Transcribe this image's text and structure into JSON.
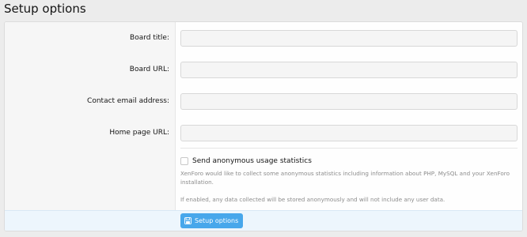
{
  "page": {
    "title": "Setup options"
  },
  "form": {
    "fields": [
      {
        "label": "Board title:",
        "value": "",
        "placeholder": ""
      },
      {
        "label": "Board URL:",
        "value": "",
        "placeholder": ""
      },
      {
        "label": "Contact email address:",
        "value": "",
        "placeholder": ""
      },
      {
        "label": "Home page URL:",
        "value": "",
        "placeholder": ""
      }
    ],
    "stats": {
      "label": "Send anonymous usage statistics",
      "checked": false,
      "hint_1": "XenForo would like to collect some anonymous statistics including information about PHP, MySQL and your XenForo installation.",
      "hint_2": "If enabled, any data collected will be stored anonymously and will not include any user data."
    }
  },
  "footer": {
    "submit_label": "Setup options",
    "submit_icon": "save-icon"
  },
  "colors": {
    "accent": "#47a7eb",
    "footer_bg": "#edf6fd"
  }
}
